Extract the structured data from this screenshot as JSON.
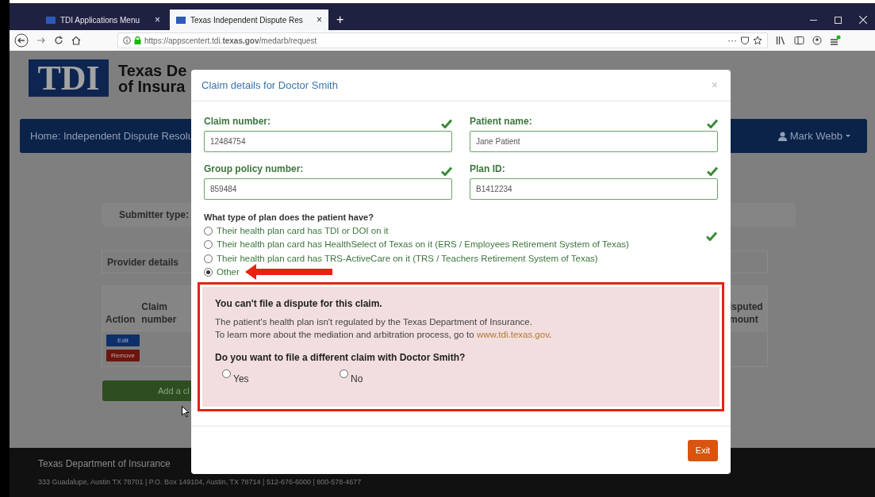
{
  "browser": {
    "tabs": [
      {
        "title": "TDI Applications Menu",
        "close": "×",
        "selected": false
      },
      {
        "title": "Texas Independent Dispute Res",
        "close": "×",
        "selected": true
      }
    ],
    "new_tab": "+",
    "url": "https://appscentert.tdi.**texas.gov**/medarb/request",
    "more": "···"
  },
  "page": {
    "logo": {
      "mark": "TDI",
      "lines": [
        "Texas De",
        "of Insura"
      ]
    },
    "nav": {
      "breadcrumb": "Home: Independent Dispute Resolu",
      "user": "Mark Webb"
    },
    "submitter_label": "Submitter type:",
    "provider_label": "Provider details",
    "table": {
      "columns": [
        {
          "lines": [
            "Action"
          ]
        },
        {
          "lines": [
            "Claim",
            "number"
          ]
        },
        {
          "lines": [
            "isputed",
            "mount"
          ]
        }
      ],
      "row_buttons": [
        {
          "label": "Edit",
          "kind": "edit"
        },
        {
          "label": "Remove",
          "kind": "remove"
        }
      ]
    },
    "add_button": "Add a cl",
    "footer": {
      "title": "Texas Department of Insurance",
      "address": "333 Guadalupe, Austin TX 78701 | P.O. Box 149104, Austin, TX 78714 | 512-676-6000 | 800-578-4677"
    }
  },
  "modal": {
    "title": "Claim details for Doctor Smith",
    "close": "×",
    "fields": [
      {
        "label": "Claim number:",
        "value": "12484754",
        "valid": true
      },
      {
        "label": "Patient name:",
        "value": "Jane Patient",
        "valid": true
      },
      {
        "label": "Group policy number:",
        "value": "859484",
        "valid": true
      },
      {
        "label": "Plan ID:",
        "value": "B1412234",
        "valid": true
      }
    ],
    "question": "What type of plan does the patient have?",
    "plan_valid": true,
    "options": [
      {
        "label": "Their health plan card has TDI or DOI on it",
        "selected": false
      },
      {
        "label": "Their health plan card has HealthSelect of Texas on it (ERS / Employees Retirement System of Texas)",
        "selected": false
      },
      {
        "label": "Their health plan card has TRS-ActiveCare on it (TRS / Teachers Retirement System of Texas)",
        "selected": false
      },
      {
        "label": "Other",
        "selected": true
      }
    ],
    "alert": {
      "title": "You can't file a dispute for this claim.",
      "line1": "The patient's health plan isn't regulated by the Texas Department of Insurance.",
      "line2_before": "To learn more about the mediation and arbitration process, go to ",
      "link": "www.tdi.texas.gov",
      "line2_after": ".",
      "question": "Do you want to file a different claim with Doctor Smith?",
      "answers": [
        {
          "label": "Yes",
          "selected": false
        },
        {
          "label": "No",
          "selected": false
        }
      ]
    },
    "exit": "Exit"
  }
}
